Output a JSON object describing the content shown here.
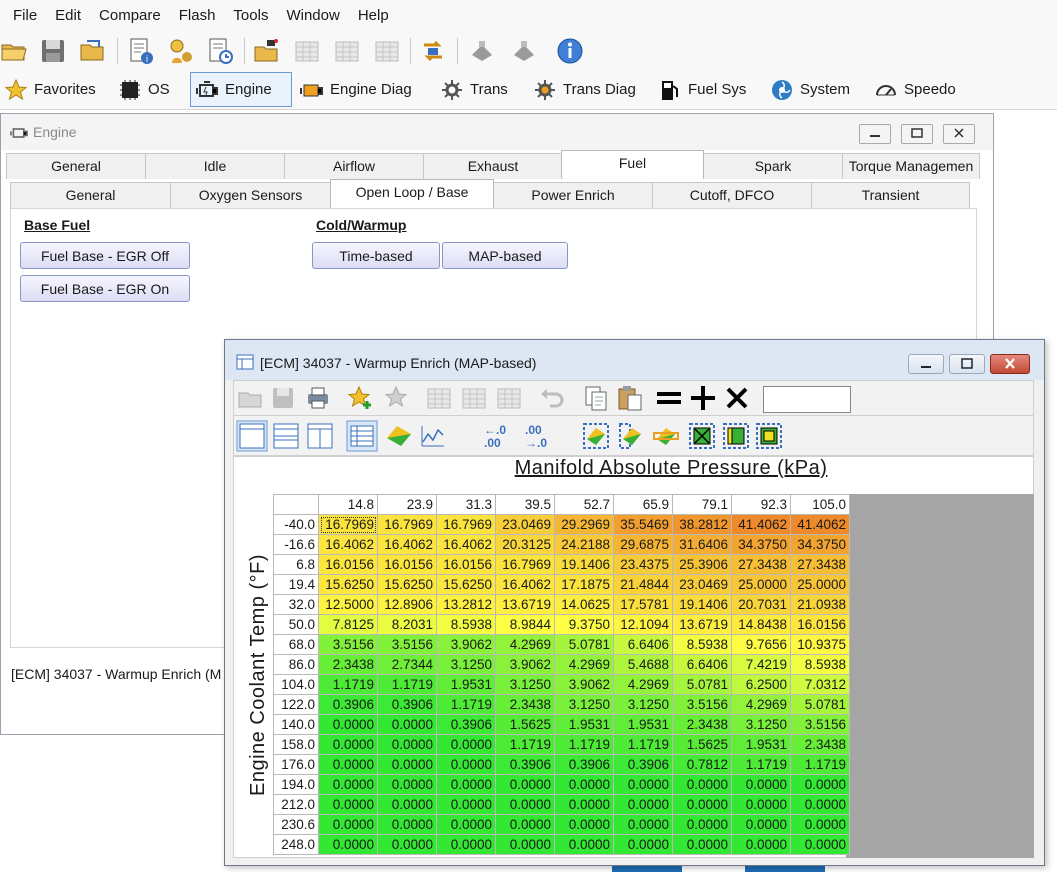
{
  "menu": [
    "File",
    "Edit",
    "Compare",
    "Flash",
    "Tools",
    "Window",
    "Help"
  ],
  "toolbar_icons": [
    "open-folder-icon",
    "save-icon",
    "open-recent-icon",
    "file-info-icon",
    "vehicle-key-icon",
    "history-icon",
    "read-vehicle-icon",
    "table-icon",
    "table-copy-icon",
    "table-paste-icon",
    "flash-swap-icon",
    "connect-icon",
    "disconnect-icon",
    "info-icon"
  ],
  "nav": {
    "favorites": "Favorites",
    "os": "OS",
    "engine": "Engine",
    "engine_diag": "Engine Diag",
    "trans": "Trans",
    "trans_diag": "Trans Diag",
    "fuel_sys": "Fuel Sys",
    "system": "System",
    "speedo": "Speedo"
  },
  "engine_window": {
    "title": "Engine",
    "tabs_top": [
      "General",
      "Idle",
      "Airflow",
      "Exhaust",
      "Fuel",
      "Spark",
      "Torque Managemen"
    ],
    "tabs_sub": [
      "General",
      "Oxygen Sensors",
      "Open Loop / Base",
      "Power Enrich",
      "Cutoff, DFCO",
      "Transient"
    ],
    "base_fuel_heading": "Base Fuel",
    "btn_egr_off": "Fuel Base - EGR Off",
    "btn_egr_on": "Fuel Base - EGR On",
    "cold_heading": "Cold/Warmup",
    "btn_time": "Time-based",
    "btn_map": "MAP-based",
    "status": "[ECM] 34037 - Warmup Enrich (M"
  },
  "table_window": {
    "title": "[ECM] 34037 - Warmup Enrich (MAP-based)",
    "x_axis_title": "Manifold Absolute Pressure (kPa)",
    "y_axis_title": "Engine Coolant Temp (°F)",
    "col_headers": [
      "14.8",
      "23.9",
      "31.3",
      "39.5",
      "52.7",
      "65.9",
      "79.1",
      "92.3",
      "105.0"
    ],
    "rows": [
      {
        "h": "-40.0",
        "v": [
          "16.7969",
          "16.7969",
          "16.7969",
          "23.0469",
          "29.2969",
          "35.5469",
          "38.2812",
          "41.4062",
          "41.4062"
        ]
      },
      {
        "h": "-16.6",
        "v": [
          "16.4062",
          "16.4062",
          "16.4062",
          "20.3125",
          "24.2188",
          "29.6875",
          "31.6406",
          "34.3750",
          "34.3750"
        ]
      },
      {
        "h": "6.8",
        "v": [
          "16.0156",
          "16.0156",
          "16.0156",
          "16.7969",
          "19.1406",
          "23.4375",
          "25.3906",
          "27.3438",
          "27.3438"
        ]
      },
      {
        "h": "19.4",
        "v": [
          "15.6250",
          "15.6250",
          "15.6250",
          "16.4062",
          "17.1875",
          "21.4844",
          "23.0469",
          "25.0000",
          "25.0000"
        ]
      },
      {
        "h": "32.0",
        "v": [
          "12.5000",
          "12.8906",
          "13.2812",
          "13.6719",
          "14.0625",
          "17.5781",
          "19.1406",
          "20.7031",
          "21.0938"
        ]
      },
      {
        "h": "50.0",
        "v": [
          "7.8125",
          "8.2031",
          "8.5938",
          "8.9844",
          "9.3750",
          "12.1094",
          "13.6719",
          "14.8438",
          "16.0156"
        ]
      },
      {
        "h": "68.0",
        "v": [
          "3.5156",
          "3.5156",
          "3.9062",
          "4.2969",
          "5.0781",
          "6.6406",
          "8.5938",
          "9.7656",
          "10.9375"
        ]
      },
      {
        "h": "86.0",
        "v": [
          "2.3438",
          "2.7344",
          "3.1250",
          "3.9062",
          "4.2969",
          "5.4688",
          "6.6406",
          "7.4219",
          "8.5938"
        ]
      },
      {
        "h": "104.0",
        "v": [
          "1.1719",
          "1.1719",
          "1.9531",
          "3.1250",
          "3.9062",
          "4.2969",
          "5.0781",
          "6.2500",
          "7.0312"
        ]
      },
      {
        "h": "122.0",
        "v": [
          "0.3906",
          "0.3906",
          "1.1719",
          "2.3438",
          "3.1250",
          "3.1250",
          "3.5156",
          "4.2969",
          "5.0781"
        ]
      },
      {
        "h": "140.0",
        "v": [
          "0.0000",
          "0.0000",
          "0.3906",
          "1.5625",
          "1.9531",
          "1.9531",
          "2.3438",
          "3.1250",
          "3.5156"
        ]
      },
      {
        "h": "158.0",
        "v": [
          "0.0000",
          "0.0000",
          "0.0000",
          "1.1719",
          "1.1719",
          "1.1719",
          "1.5625",
          "1.9531",
          "2.3438"
        ]
      },
      {
        "h": "176.0",
        "v": [
          "0.0000",
          "0.0000",
          "0.0000",
          "0.3906",
          "0.3906",
          "0.3906",
          "0.7812",
          "1.1719",
          "1.1719"
        ]
      },
      {
        "h": "194.0",
        "v": [
          "0.0000",
          "0.0000",
          "0.0000",
          "0.0000",
          "0.0000",
          "0.0000",
          "0.0000",
          "0.0000",
          "0.0000"
        ]
      },
      {
        "h": "212.0",
        "v": [
          "0.0000",
          "0.0000",
          "0.0000",
          "0.0000",
          "0.0000",
          "0.0000",
          "0.0000",
          "0.0000",
          "0.0000"
        ]
      },
      {
        "h": "230.6",
        "v": [
          "0.0000",
          "0.0000",
          "0.0000",
          "0.0000",
          "0.0000",
          "0.0000",
          "0.0000",
          "0.0000",
          "0.0000"
        ]
      },
      {
        "h": "248.0",
        "v": [
          "0.0000",
          "0.0000",
          "0.0000",
          "0.0000",
          "0.0000",
          "0.0000",
          "0.0000",
          "0.0000",
          "0.0000"
        ]
      }
    ],
    "color_scale": {
      "min": 0,
      "max": 41.4062,
      "low": "#33e833",
      "mid": "#ffff44",
      "high": "#ef8a2a"
    }
  }
}
